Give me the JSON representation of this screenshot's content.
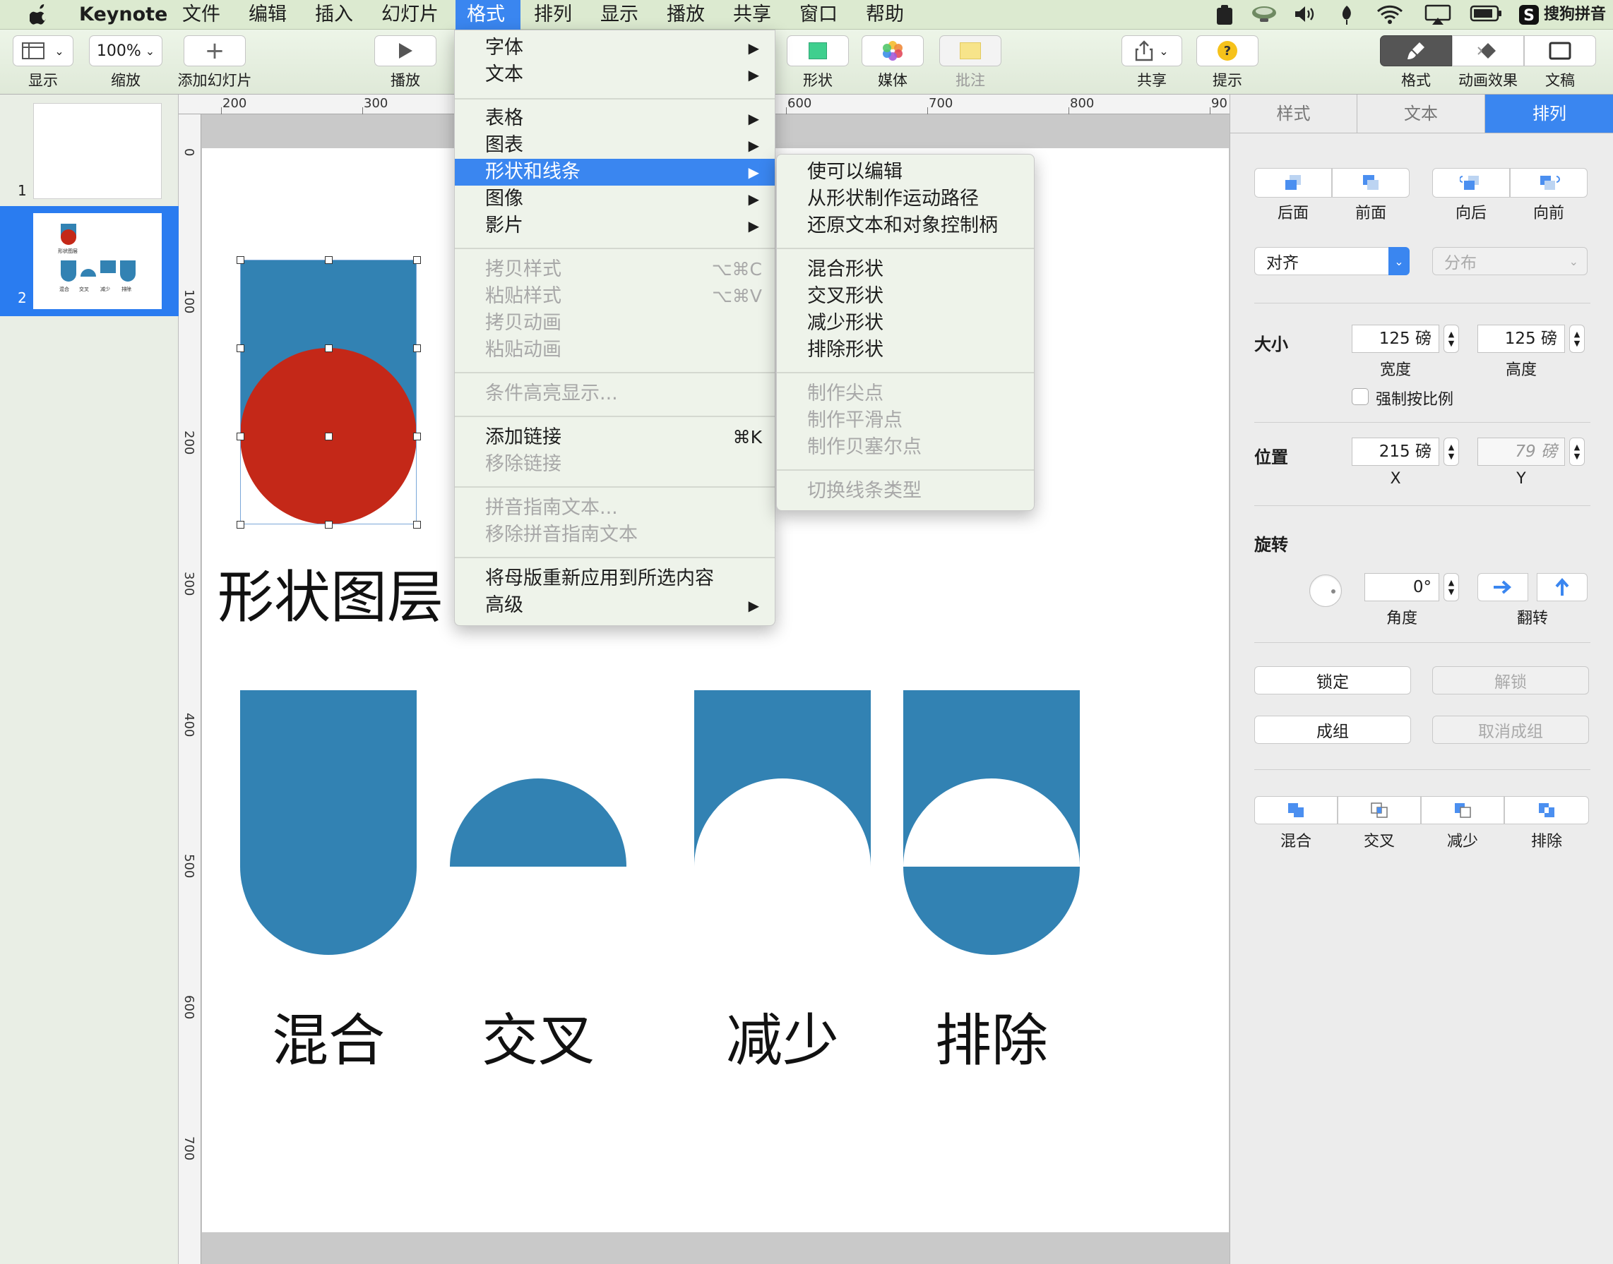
{
  "menubar": {
    "apple": "",
    "items": [
      "Keynote",
      "文件",
      "编辑",
      "插入",
      "幻灯片",
      "格式",
      "排列",
      "显示",
      "播放",
      "共享",
      "窗口",
      "帮助"
    ],
    "active_index": 5,
    "ime": "搜狗拼音"
  },
  "toolbar": {
    "view_label": "显示",
    "zoom_value": "100%",
    "zoom_label": "缩放",
    "add_slide_label": "添加幻灯片",
    "play_label": "播放",
    "shape_label": "形状",
    "media_label": "媒体",
    "comment_label": "批注",
    "share_label": "共享",
    "tips_label": "提示",
    "format_label": "格式",
    "animate_label": "动画效果",
    "document_label": "文稿"
  },
  "navigator": {
    "slides": [
      {
        "number": "1"
      },
      {
        "number": "2",
        "selected": true,
        "mini_labels": [
          "形状图层",
          "混合",
          "交叉",
          "减少",
          "排除"
        ]
      }
    ]
  },
  "rulers": {
    "horizontal": [
      "200",
      "300",
      "600",
      "700",
      "800",
      "90"
    ],
    "vertical": [
      "0",
      "100",
      "200",
      "300",
      "400",
      "500",
      "600",
      "700"
    ]
  },
  "slide": {
    "title": "形状图层",
    "shape_labels": [
      "混合",
      "交叉",
      "减少",
      "排除"
    ],
    "colors": {
      "blue": "#3282b3",
      "red": "#c42818"
    }
  },
  "format_menu": {
    "items": [
      {
        "label": "字体",
        "submenu": true
      },
      {
        "label": "文本",
        "submenu": true
      },
      {
        "label": "表格",
        "submenu": true
      },
      {
        "label": "图表",
        "submenu": true
      },
      {
        "label": "形状和线条",
        "submenu": true,
        "highlighted": true
      },
      {
        "label": "图像",
        "submenu": true
      },
      {
        "label": "影片",
        "submenu": true
      },
      {
        "label": "拷贝样式",
        "shortcut": "⌥⌘C",
        "disabled": true
      },
      {
        "label": "粘贴样式",
        "shortcut": "⌥⌘V",
        "disabled": true
      },
      {
        "label": "拷贝动画",
        "disabled": true
      },
      {
        "label": "粘贴动画",
        "disabled": true
      },
      {
        "label": "条件高亮显示...",
        "disabled": true
      },
      {
        "label": "添加链接",
        "shortcut": "⌘K"
      },
      {
        "label": "移除链接",
        "disabled": true
      },
      {
        "label": "拼音指南文本...",
        "disabled": true
      },
      {
        "label": "移除拼音指南文本",
        "disabled": true
      },
      {
        "label": "将母版重新应用到所选内容"
      },
      {
        "label": "高级",
        "submenu": true
      }
    ]
  },
  "shapes_submenu": {
    "items": [
      {
        "label": "使可以编辑"
      },
      {
        "label": "从形状制作运动路径"
      },
      {
        "label": "还原文本和对象控制柄"
      },
      {
        "label": "混合形状"
      },
      {
        "label": "交叉形状"
      },
      {
        "label": "减少形状"
      },
      {
        "label": "排除形状"
      },
      {
        "label": "制作尖点",
        "disabled": true
      },
      {
        "label": "制作平滑点",
        "disabled": true
      },
      {
        "label": "制作贝塞尔点",
        "disabled": true
      },
      {
        "label": "切换线条类型",
        "disabled": true
      }
    ]
  },
  "inspector": {
    "tabs": [
      "样式",
      "文本",
      "排列"
    ],
    "active_tab": 2,
    "order": [
      "后面",
      "前面",
      "向后",
      "向前"
    ],
    "align_label": "对齐",
    "distribute_label": "分布",
    "size_label": "大小",
    "width_value": "125 磅",
    "width_label": "宽度",
    "height_value": "125 磅",
    "height_label": "高度",
    "constrain_label": "强制按比例",
    "position_label": "位置",
    "x_value": "215 磅",
    "x_label": "X",
    "y_value": "79 磅",
    "y_label": "Y",
    "rotate_label": "旋转",
    "angle_value": "0°",
    "angle_label": "角度",
    "flip_label": "翻转",
    "lock_label": "锁定",
    "unlock_label": "解锁",
    "group_label": "成组",
    "ungroup_label": "取消成组",
    "combine_buttons": [
      "混合",
      "交叉",
      "减少",
      "排除"
    ]
  }
}
